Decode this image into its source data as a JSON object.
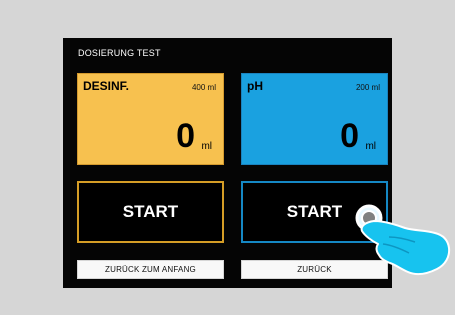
{
  "screen": {
    "title": "DOSIERUNG TEST"
  },
  "panels": {
    "desinf": {
      "label": "DESINF.",
      "capacity": "400 ml",
      "value": "0",
      "unit": "ml"
    },
    "ph": {
      "label": "pH",
      "capacity": "200 ml",
      "value": "0",
      "unit": "ml"
    }
  },
  "buttons": {
    "start_desinf": "START",
    "start_ph": "START",
    "back_to_start": "ZURÜCK ZUM ANFANG",
    "back": "ZURÜCK"
  },
  "colors": {
    "background": "#d6d6d6",
    "screen": "#050505",
    "desinf": "#f7c14f",
    "ph": "#1aa1e0",
    "desinf_border": "#d59d26",
    "ph_border": "#1588c4"
  },
  "icons": {
    "touch_hand": "touch-hand-icon",
    "tap_indicator": "tap-indicator-icon"
  }
}
